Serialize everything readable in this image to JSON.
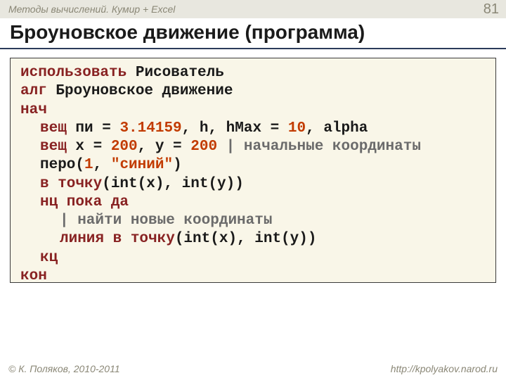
{
  "header": {
    "breadcrumb": "Методы вычислений. Кумир + Excel",
    "page_number": "81"
  },
  "title": "Броуновское движение (программа)",
  "code": {
    "l1": {
      "kw": "использовать",
      "rest": " Рисователь"
    },
    "l2": {
      "kw": "алг",
      "rest": " Броуновское движение"
    },
    "l3": {
      "kw": "нач"
    },
    "l4": {
      "kw": "вещ",
      "a": " пи = ",
      "v1": "3.14159",
      "b": ", h, hMax = ",
      "v2": "10",
      "c": ", alpha"
    },
    "l5": {
      "kw": "вещ",
      "a": " x = ",
      "v1": "200",
      "b": ", y = ",
      "v2": "200",
      "cmt": " | начальные координаты"
    },
    "l6": {
      "a": "перо(",
      "v1": "1",
      "b": ", ",
      "s": "\"синий\"",
      "c": ")"
    },
    "l7": {
      "kw": "в точку",
      "a": "(int(x), int(y))"
    },
    "l8": {
      "kw1": "нц пока",
      "kw2": " да"
    },
    "l9": {
      "cmt": "| найти новые координаты"
    },
    "l10": {
      "kw": "линия в точку",
      "a": "(int(x), int(y))"
    },
    "l11": {
      "kw": "кц"
    },
    "l12": {
      "kw": "кон"
    }
  },
  "footer": {
    "copyright": "© К. Поляков, 2010-2011",
    "url": "http://kpolyakov.narod.ru"
  }
}
